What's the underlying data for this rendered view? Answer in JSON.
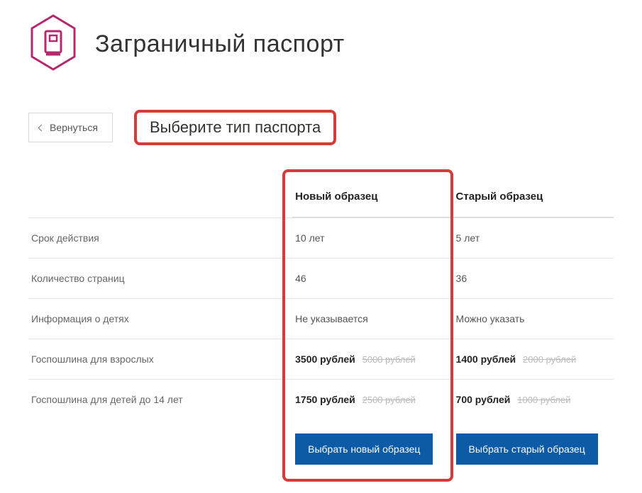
{
  "header": {
    "title": "Заграничный паспорт"
  },
  "nav": {
    "back_label": "Вернуться",
    "subtitle": "Выберите тип паспорта"
  },
  "columns": {
    "new": "Новый образец",
    "old": "Старый образец"
  },
  "rows": {
    "validity": {
      "label": "Срок действия",
      "new": "10 лет",
      "old": "5 лет"
    },
    "pages": {
      "label": "Количество страниц",
      "new": "46",
      "old": "36"
    },
    "children": {
      "label": "Информация о детях",
      "new": "Не указывается",
      "old": "Можно указать"
    },
    "fee_adult": {
      "label": "Госпошлина для взрослых",
      "new_price": "3500 рублей",
      "new_strike": "5000 рублей",
      "old_price": "1400 рублей",
      "old_strike": "2000 рублей"
    },
    "fee_child": {
      "label": "Госпошлина для детей до 14 лет",
      "new_price": "1750 рублей",
      "new_strike": "2500 рублей",
      "old_price": "700 рублей",
      "old_strike": "1000 рублей"
    }
  },
  "buttons": {
    "choose_new": "Выбрать новый образец",
    "choose_old": "Выбрать старый образец"
  }
}
